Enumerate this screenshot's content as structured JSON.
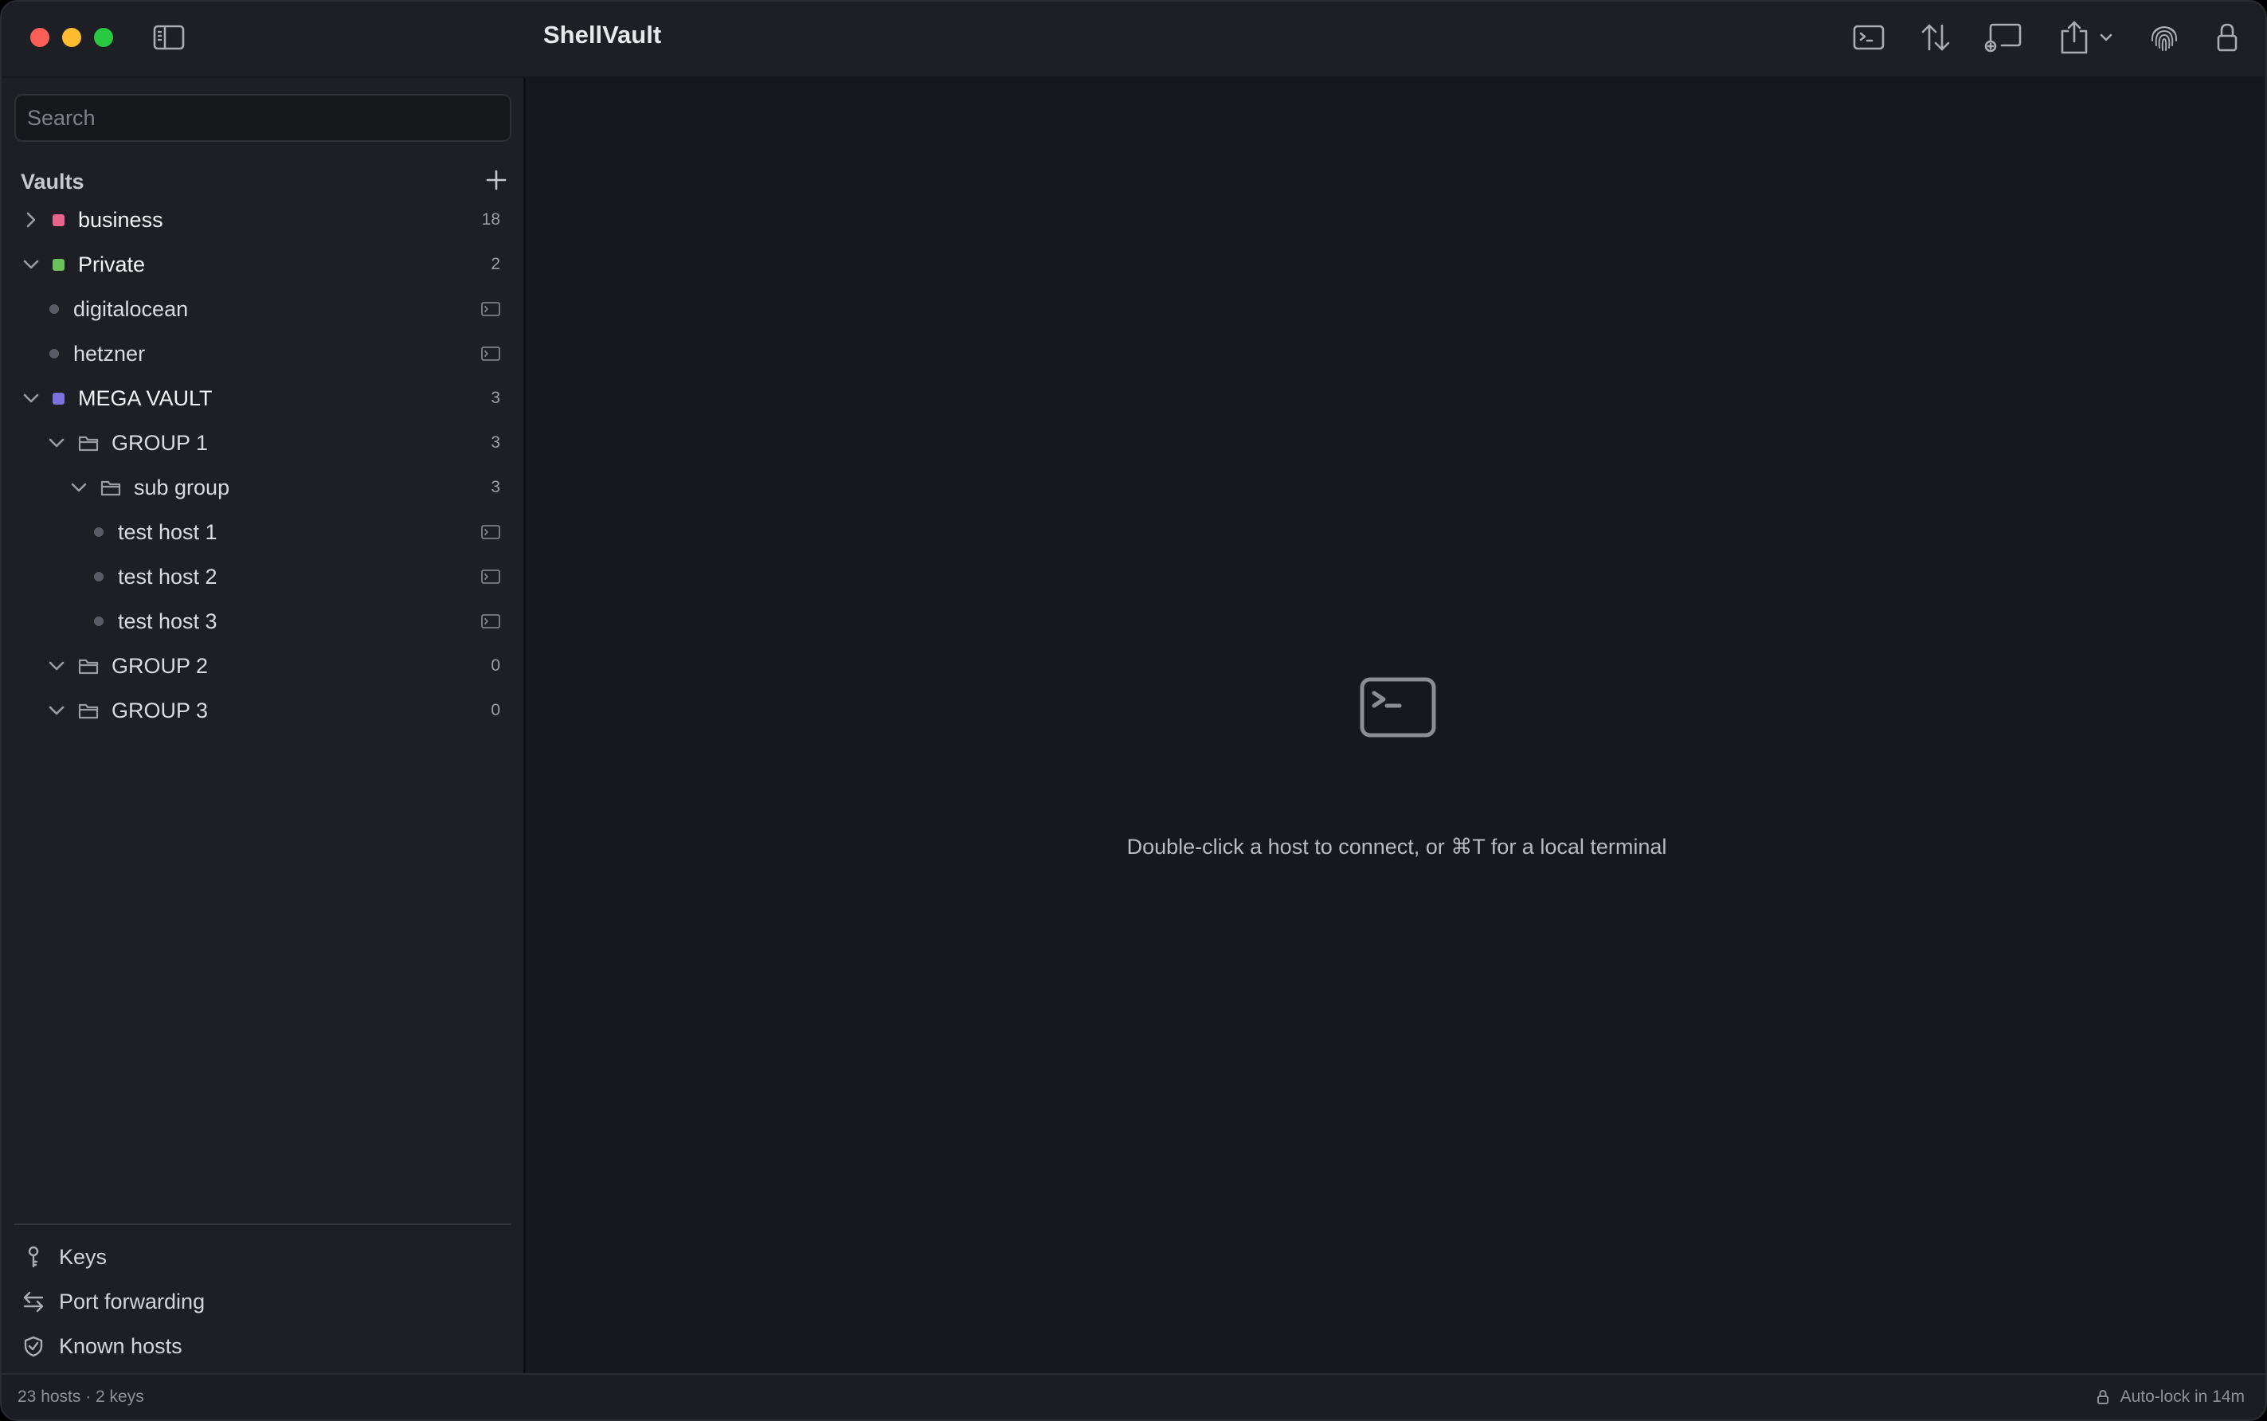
{
  "app": {
    "title": "ShellVault"
  },
  "search": {
    "placeholder": "Search",
    "value": ""
  },
  "sidebar": {
    "vaults_title": "Vaults",
    "tree": [
      {
        "kind": "vault",
        "label": "business",
        "color": "#e8648a",
        "expanded": false,
        "count": "18"
      },
      {
        "kind": "vault",
        "label": "Private",
        "color": "#6cc25a",
        "expanded": true,
        "count": "2"
      },
      {
        "kind": "host",
        "label": "digitalocean"
      },
      {
        "kind": "host",
        "label": "hetzner"
      },
      {
        "kind": "vault",
        "label": "MEGA VAULT",
        "color": "#7b72e0",
        "expanded": true,
        "count": "3"
      },
      {
        "kind": "group",
        "label": "GROUP 1",
        "expanded": true,
        "count": "3"
      },
      {
        "kind": "subgroup",
        "label": "sub group",
        "expanded": true,
        "count": "3"
      },
      {
        "kind": "subhost",
        "label": "test host 1"
      },
      {
        "kind": "subhost",
        "label": "test host 2"
      },
      {
        "kind": "subhost",
        "label": "test host 3"
      },
      {
        "kind": "group",
        "label": "GROUP 2",
        "expanded": true,
        "count": "0"
      },
      {
        "kind": "group",
        "label": "GROUP 3",
        "expanded": true,
        "count": "0"
      }
    ],
    "bottom_nav": [
      {
        "label": "Keys",
        "icon": "key-icon"
      },
      {
        "label": "Port forwarding",
        "icon": "arrows-swap-icon"
      },
      {
        "label": "Known hosts",
        "icon": "shield-check-icon"
      }
    ]
  },
  "main": {
    "empty_icon": "terminal-icon",
    "empty_text": "Double-click a host to connect, or ⌘T for a local terminal"
  },
  "status": {
    "left": "23 hosts · 2 keys",
    "right": "Auto-lock in 14m"
  }
}
